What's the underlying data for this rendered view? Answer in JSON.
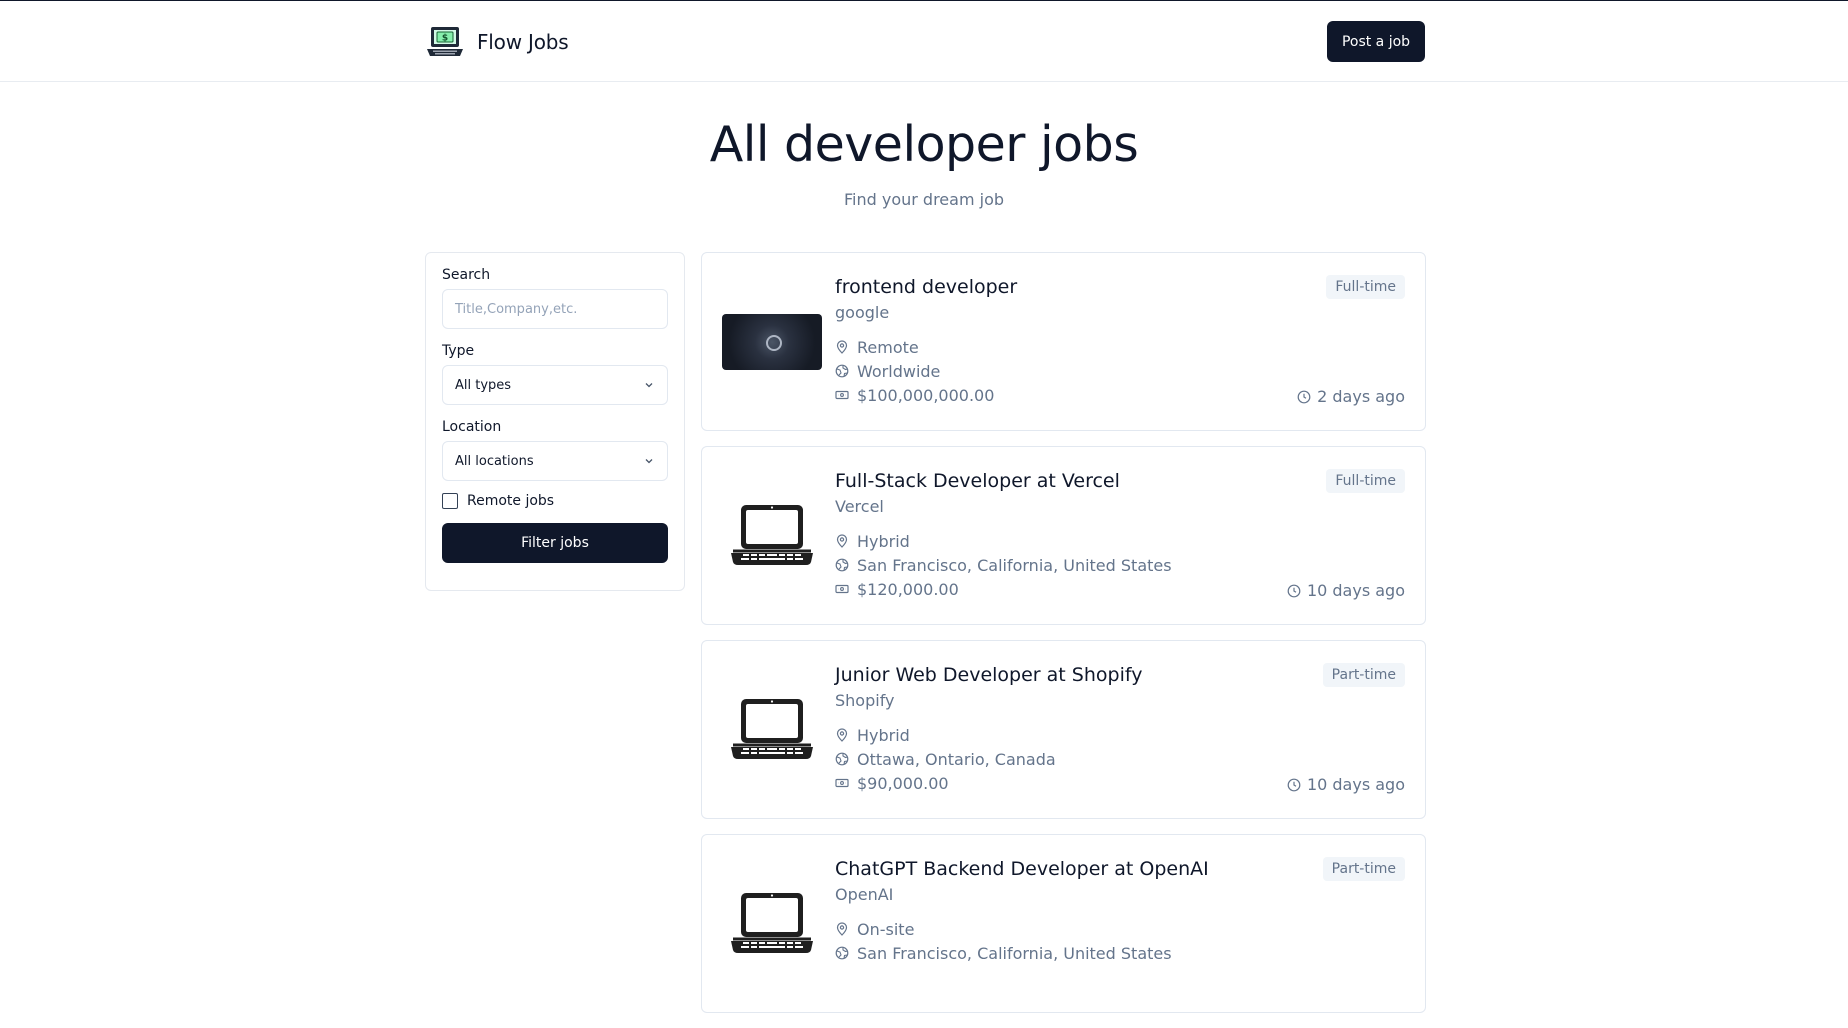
{
  "header": {
    "brand_name": "Flow Jobs",
    "post_button": "Post a job"
  },
  "hero": {
    "title": "All developer jobs",
    "subtitle": "Find your dream job"
  },
  "filters": {
    "search_label": "Search",
    "search_placeholder": "Title,Company,etc.",
    "type_label": "Type",
    "type_value": "All types",
    "location_label": "Location",
    "location_value": "All locations",
    "remote_label": "Remote jobs",
    "remote_checked": false,
    "filter_button": "Filter jobs"
  },
  "jobs": [
    {
      "title": "frontend developer",
      "company": "google",
      "work_mode": "Remote",
      "location": "Worldwide",
      "salary": "$100,000,000.00",
      "type": "Full-time",
      "posted": "2 days ago",
      "logo": "photo"
    },
    {
      "title": "Full-Stack Developer at Vercel",
      "company": "Vercel",
      "work_mode": "Hybrid",
      "location": "San Francisco, California, United States",
      "salary": "$120,000.00",
      "type": "Full-time",
      "posted": "10 days ago",
      "logo": "laptop-icon"
    },
    {
      "title": "Junior Web Developer at Shopify",
      "company": "Shopify",
      "work_mode": "Hybrid",
      "location": "Ottawa, Ontario, Canada",
      "salary": "$90,000.00",
      "type": "Part-time",
      "posted": "10 days ago",
      "logo": "laptop-icon"
    },
    {
      "title": "ChatGPT Backend Developer at OpenAI",
      "company": "OpenAI",
      "work_mode": "On-site",
      "location": "San Francisco, California, United States",
      "salary": "",
      "type": "Part-time",
      "posted": "",
      "logo": "laptop-icon"
    }
  ],
  "colors": {
    "primary": "#0f172a",
    "muted_text": "#64748b",
    "border": "#e2e8f0",
    "badge_bg": "#f1f5f9"
  }
}
